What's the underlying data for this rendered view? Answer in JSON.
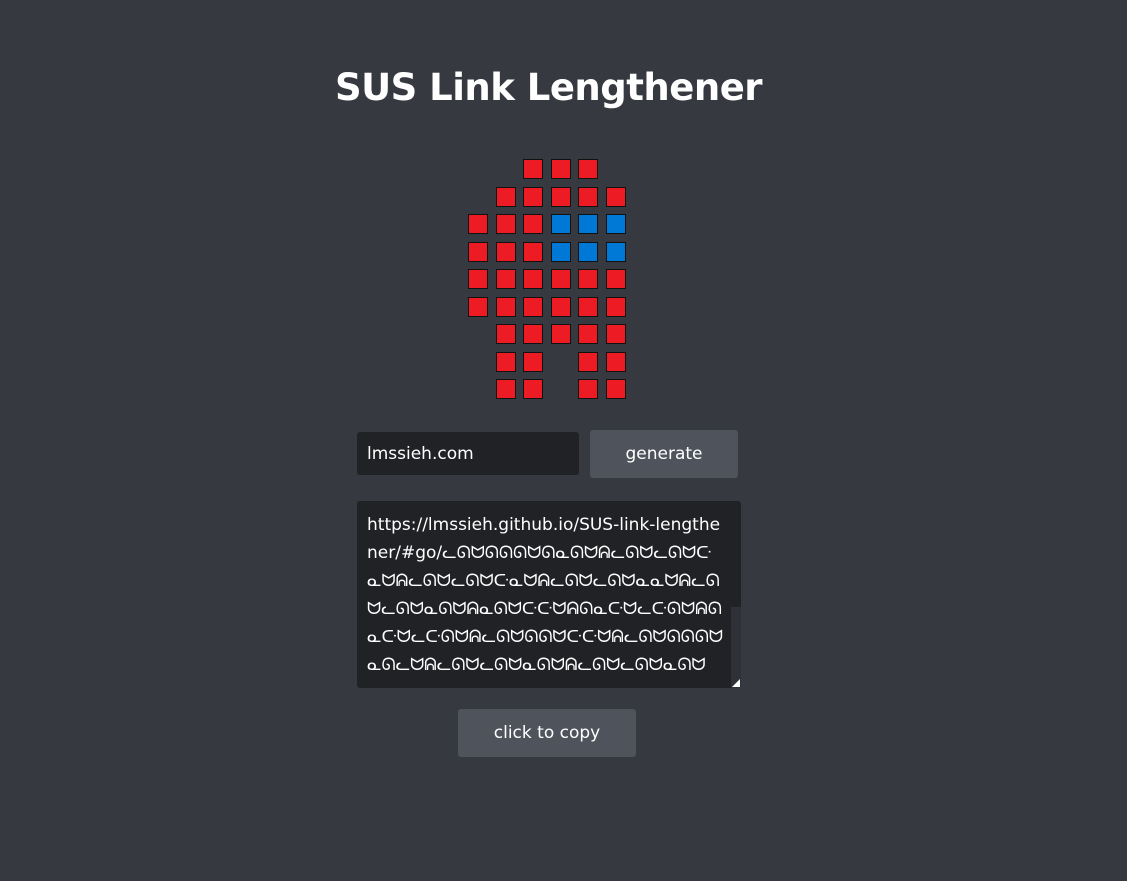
{
  "header": {
    "title": "SUS Link Lengthener"
  },
  "mascot": {
    "name": "crewmate-pixel-art",
    "colors": {
      "body": "#ed1c24",
      "visor": "#0079d6",
      "outline": "#111111"
    },
    "grid": [
      "..RRR.",
      ".RRRRR",
      "RRRBBB",
      "RRRBBB",
      "RRRRRR",
      "RRRRRR",
      ".RRRRR",
      ".RR.RR",
      ".RR.RR"
    ]
  },
  "form": {
    "url_value": "lmssieh.com",
    "generate_label": "generate"
  },
  "output": {
    "text": "https://lmssieh.github.io/SUS-link-lengthener/#go/ᓚᘏᗢᘏᘏᘏᗢᘏᓇᘏᗢᕱᓚᘏᗢᓚᘏᗢᑢᓇᗢᕱᓚᘏᗢᓚᘏᗢᑢᓇᗢᕱᓚᘏᗢᓚᘏᗢᓇᓇᗢᕱᓚᘏᗢᓚᘏᗢᓇᘏᗢᕱᓇᘏᗢᑢᑢᗢᕱᘏᓇᑢᗢᓚᑢᘏᗢᕱᘏᓇᑢᗢᓚᑢᘏᗢᕱᓚᘏᗢᘏᘏᗢᑢᑢᗢᕱᓚᘏᗢᘏᘏᘏᗢᓇᘏᓚᗢᕱᓚᘏᗢᓚᘏᗢᓇᘏᗢᕱᓚᘏᗢᓚᘏᗢᓇᘏᗢ"
  },
  "copy": {
    "label": "click to copy"
  }
}
